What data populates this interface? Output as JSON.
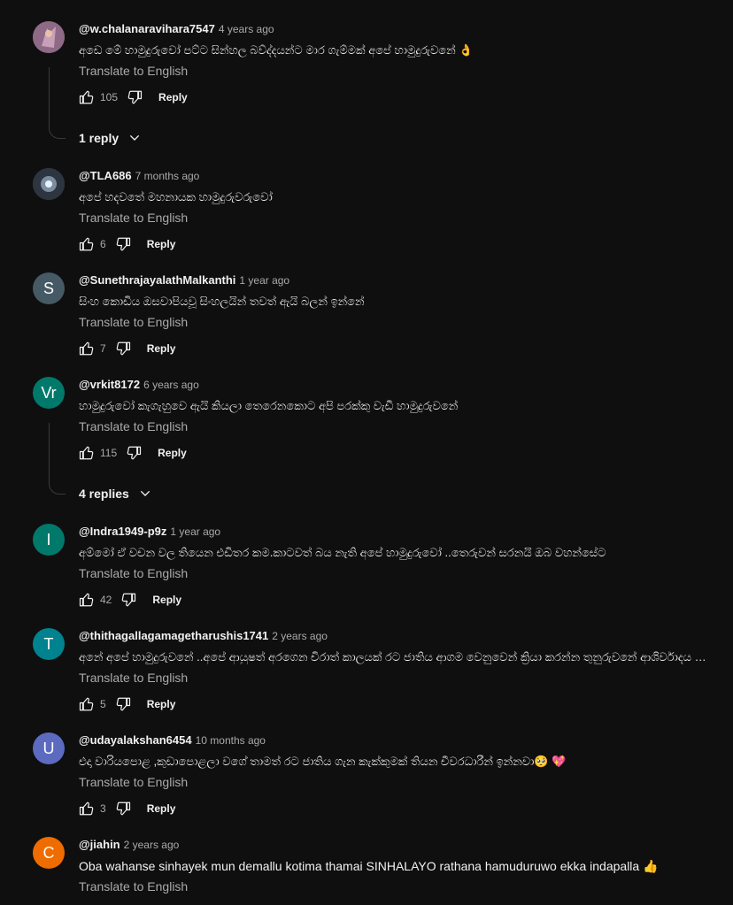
{
  "ui": {
    "translate_label": "Translate to English",
    "reply_label": "Reply"
  },
  "colors": {
    "background": "#0f0f0f",
    "text": "#f1f1f1",
    "muted": "#aaaaaa"
  },
  "comments": [
    {
      "handle": "@w.chalanaravihara7547",
      "time": "4 years ago",
      "text": "අඩෙ මේ හාමුදුරුවෝ පට්ට සින්හල  බව්ද්දයන්ට මාර ගැම්මක් අපේ හාමුදුරුවනේ 👌",
      "likes": "105",
      "replies": "1 reply",
      "avatar_letter": "",
      "avatar_color": "#7a5c6e"
    },
    {
      "handle": "@TLA686",
      "time": "7 months ago",
      "text": "අපේ හදවතේ මහනායක හාමුදුරුවරුවෝ",
      "likes": "6",
      "replies": "",
      "avatar_letter": "",
      "avatar_color": "#3b4654"
    },
    {
      "handle": "@SunethrajayalathMalkanthi",
      "time": "1 year ago",
      "text": "සිංහ කොඩිය ඔසවාපියවූ සිංහලයින් තවත් ඇයි බලන් ඉන්නේ",
      "likes": "7",
      "replies": "",
      "avatar_letter": "S",
      "avatar_color": "#455a64"
    },
    {
      "handle": "@vrkit8172",
      "time": "6 years ago",
      "text": "හාමුදුරුවෝ කැගැහුවෙ ඇයි කියලා  තෙරෙනකොට අපි පරක්කු වැඩී හාමුදුරුවනේ",
      "likes": "115",
      "replies": "4 replies",
      "avatar_letter": "Vr",
      "avatar_color": "#00796b"
    },
    {
      "handle": "@Indra1949-p9z",
      "time": "1 year ago",
      "text": "අම්මෝ ඒ වචන වල තියෙන එඩිතර කම.කාටවත් බය නැති අපේ හාමුදුරුවෝ ..තෙරුවන් සරනයි ඔබ වහන්සේට",
      "likes": "42",
      "replies": "",
      "avatar_letter": "I",
      "avatar_color": "#00796b"
    },
    {
      "handle": "@thithagallagamagetharushis1741",
      "time": "2 years ago",
      "text": "අනේ අපේ හාමුදුරුවනේ ..අපේ ආයුෂත් අරගෙන චිරාත් කාලයක් රට ජාතිය ආගම වෙනුවෙන් ක්‍රියා කරන්න තුනුරුවනේ ආශිර්වාදය ලැබේවා...",
      "likes": "5",
      "replies": "",
      "avatar_letter": "T",
      "avatar_color": "#00838f"
    },
    {
      "handle": "@udayalakshan6454",
      "time": "10 months ago",
      "text": "එදා වාරියපොළ ,කුඩාපොළලා වගේ තාමත් රට ජාතිය ගැන කැක්කුමක් තියන චීවරධාරීන්  ඉන්නවා🥺 💖",
      "likes": "3",
      "replies": "",
      "avatar_letter": "U",
      "avatar_color": "#5c6bc0"
    },
    {
      "handle": "@jiahin",
      "time": "2 years ago",
      "text": "Oba wahanse sinhayek mun demallu kotima thamai SINHALAYO  rathana  hamuduruwo  ekka indapalla 👍",
      "likes": "",
      "replies": "",
      "avatar_letter": "C",
      "avatar_color": "#ef6c00"
    }
  ]
}
